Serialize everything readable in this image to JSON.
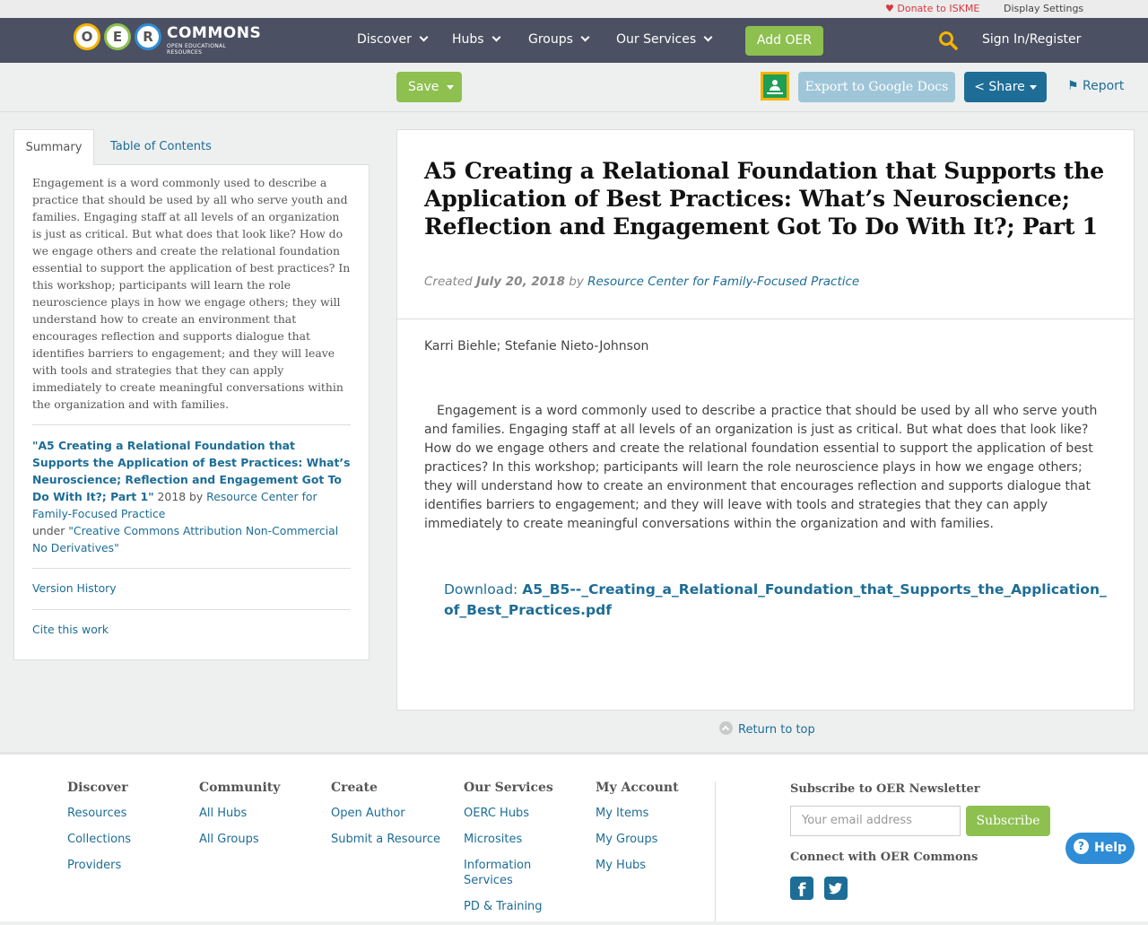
{
  "utility": {
    "donate": "Donate to ISKME",
    "display_settings": "Display Settings"
  },
  "nav": {
    "logo": {
      "letters": [
        "O",
        "E",
        "R"
      ],
      "word": "COMMONS",
      "tagline": "OPEN EDUCATIONAL RESOURCES"
    },
    "items": [
      "Discover",
      "Hubs",
      "Groups",
      "Our Services"
    ],
    "add_oer": "Add OER",
    "sign_in": "Sign In/Register"
  },
  "toolbar": {
    "save": "Save",
    "export": "Export to Google Docs",
    "share": "Share",
    "report": "Report"
  },
  "sidebar": {
    "tabs": [
      "Summary",
      "Table of Contents"
    ],
    "summary": "Engagement is a word commonly used to describe a practice that should be used by all who serve youth and families. Engaging staff at all levels of an organization is just as critical. But what does that look like? How do we engage others and create the relational foundation essential to support the application of best practices? In this workshop; participants will learn the role neuroscience plays in how we engage others; they will understand how to create an environment that encourages reflection and supports dialogue that identifies barriers to engagement; and they will leave with tools and strategies that they can apply immediately to create meaningful conversations within the organization and with families.",
    "attribution": {
      "title": "\"A5 Creating a Relational Foundation that Supports the Application of Best Practices: What’s Neuroscience; Reflection and Engagement Got To Do With It?; Part 1\"",
      "year_by": " 2018 by ",
      "org": "Resource Center for Family-Focused Practice",
      "under": "under ",
      "license": "\"Creative Commons Attribution Non-Commercial No Derivatives\""
    },
    "version_history": "Version History",
    "cite": "Cite this work"
  },
  "main": {
    "title": "A5 Creating a Relational Foundation that Supports the Application of Best Practices: What’s Neuroscience; Reflection and Engagement Got To Do With It?; Part 1",
    "created_label": "Created ",
    "date": "July 20, 2018",
    "by_label": " by ",
    "org": "Resource Center for Family-Focused Practice",
    "authors": "Karri Biehle; Stefanie Nieto-Johnson",
    "description": "Engagement is a word commonly used to describe a practice that should be used by all who serve youth and families. Engaging staff at all levels of an organization is just as critical. But what does that look like? How do we engage others and create the relational foundation essential to support the application of best practices? In this workshop; participants will learn the role neuroscience plays in how we engage others; they will understand how to create an environment that encourages reflection and supports dialogue that identifies barriers to engagement; and they will leave with tools and strategies that they can apply immediately to create meaningful conversations within the organization and with families.",
    "download_label": "Download: ",
    "download_file": "A5_B5--_Creating_a_Relational_Foundation_that_Supports_the_Application_of_Best_Practices.pdf"
  },
  "return_to_top": "Return to top",
  "footer": {
    "columns": [
      {
        "heading": "Discover",
        "links": [
          "Resources",
          "Collections",
          "Providers"
        ]
      },
      {
        "heading": "Community",
        "links": [
          "All Hubs",
          "All Groups"
        ]
      },
      {
        "heading": "Create",
        "links": [
          "Open Author",
          "Submit a Resource"
        ]
      },
      {
        "heading": "Our Services",
        "links": [
          "OERC Hubs",
          "Microsites",
          "Information Services",
          "PD & Training"
        ]
      },
      {
        "heading": "My Account",
        "links": [
          "My Items",
          "My Groups",
          "My Hubs"
        ]
      }
    ],
    "newsletter_heading": "Subscribe to OER Newsletter",
    "email_placeholder": "Your email address",
    "subscribe": "Subscribe",
    "connect": "Connect with OER Commons",
    "facebook_glyph": "f"
  },
  "help": "Help",
  "colors": {
    "nav_bg": "#4b5062",
    "accent_green": "#8dc04f",
    "link_blue": "#1d6d96",
    "export_blue": "#9fc5d8",
    "donate_red": "#d9363e"
  }
}
